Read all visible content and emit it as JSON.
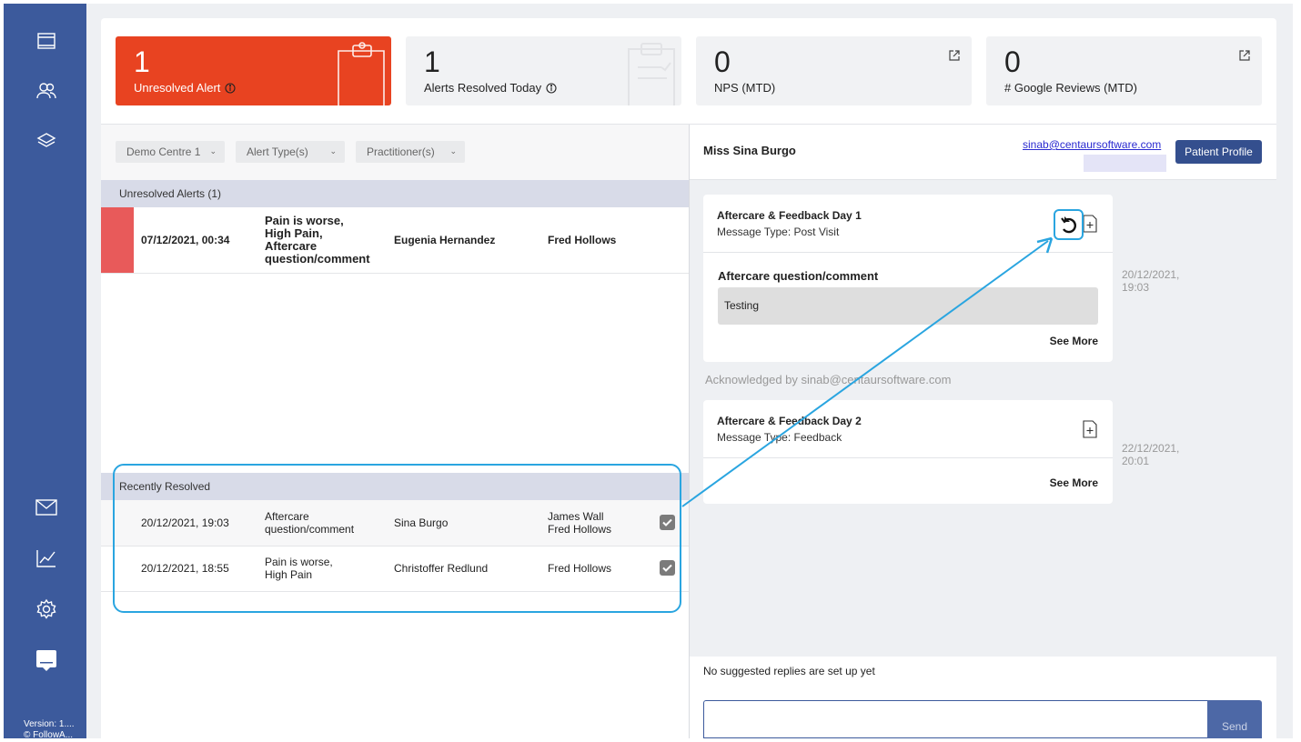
{
  "sidebar": {
    "icons": [
      "dashboard-icon",
      "patients-icon",
      "layers-icon",
      "mail-icon",
      "analytics-icon",
      "settings-icon",
      "chat-icon"
    ],
    "version": "Version: 1....",
    "copyright": "© FollowA..."
  },
  "kpis": [
    {
      "value": "1",
      "label": "Unresolved Alert",
      "color": "#e84321"
    },
    {
      "value": "1",
      "label": "Alerts Resolved Today"
    },
    {
      "value": "0",
      "label": "NPS (MTD)"
    },
    {
      "value": "0",
      "label": "# Google Reviews (MTD)"
    }
  ],
  "filters": [
    "Demo Centre 1",
    "Alert Type(s)",
    "Practitioner(s)"
  ],
  "unresolved": {
    "header": "Unresolved Alerts (1)",
    "rows": [
      {
        "date": "07/12/2021, 00:34",
        "type_lines": [
          "Pain is worse,",
          "High Pain,",
          "Aftercare",
          "question/comment"
        ],
        "patient": "Eugenia Hernandez",
        "practitioner": "Fred Hollows"
      }
    ]
  },
  "resolved": {
    "header": "Recently Resolved",
    "rows": [
      {
        "date": "20/12/2021, 19:03",
        "type_lines": [
          "Aftercare",
          "question/comment"
        ],
        "patient": "Sina Burgo",
        "practitioner_lines": [
          "James Wall",
          "Fred Hollows"
        ]
      },
      {
        "date": "20/12/2021, 18:55",
        "type_lines": [
          "Pain is worse,",
          "High Pain"
        ],
        "patient": "Christoffer Redlund",
        "practitioner_lines": [
          "Fred Hollows"
        ]
      }
    ]
  },
  "patient": {
    "name": "Miss Sina Burgo",
    "email": "sinab@centaursoftware.com",
    "profile_button": "Patient Profile"
  },
  "messages": [
    {
      "title": "Aftercare & Feedback Day 1",
      "type": "Message Type: Post Visit",
      "question": "Aftercare question/comment",
      "answer": "Testing",
      "see_more": "See More",
      "time_lines": [
        "20/12/2021,",
        "19:03"
      ]
    },
    {
      "title": "Aftercare & Feedback Day 2",
      "type": "Message Type: Feedback",
      "see_more": "See More",
      "time_lines": [
        "22/12/2021,",
        "20:01"
      ]
    }
  ],
  "acknowledged": "Acknowledged by sinab@centaursoftware.com",
  "suggested_replies": "No suggested replies are set up yet",
  "send_label": "Send",
  "accent_color": "#2aa5e0",
  "brand_color": "#3c5a9c"
}
